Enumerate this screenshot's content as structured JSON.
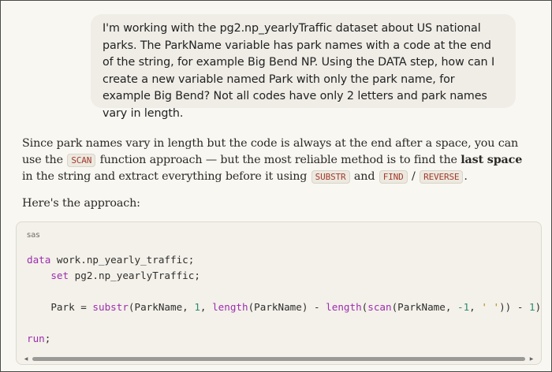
{
  "user_message": {
    "text": "I'm working with the pg2.np_yearlyTraffic dataset about US national parks. The ParkName variable has park names with a code at the end of the string, for example Big Bend NP. Using the DATA step, how can I create a new variable named Park with only the park name, for example Big Bend? Not all codes have only 2 letters and park names vary in length."
  },
  "assistant": {
    "para1_a": "Since park names vary in length but the code is always at the end after a space, you can use the ",
    "para1_code1": "SCAN",
    "para1_b": " function approach — but the most reliable method is to find the ",
    "para1_bold": "last space",
    "para1_c": " in the string and extract everything before it using ",
    "para1_code2": "SUBSTR",
    "para1_and": " and ",
    "para1_code3": "FIND",
    "para1_slash": " / ",
    "para1_code4": "REVERSE",
    "para1_end": ".",
    "para2": "Here's the approach:"
  },
  "code_block": {
    "language": "sas",
    "line1_kw": "data",
    "line1_rest": " work.np_yearly_traffic;",
    "line2_indent": "    ",
    "line2_kw": "set",
    "line2_rest": " pg2.np_yearlyTraffic;",
    "line3_a": "    Park = ",
    "line3_fn1": "substr",
    "line3_b": "(ParkName, ",
    "line3_n1": "1",
    "line3_c": ", ",
    "line3_fn2": "length",
    "line3_d": "(ParkName) - ",
    "line3_fn3": "length",
    "line3_e": "(",
    "line3_fn4": "scan",
    "line3_f": "(ParkName, ",
    "line3_n2": "-1",
    "line3_g": ", ",
    "line3_str": "' '",
    "line3_h": ")) - ",
    "line3_n3": "1",
    "line3_i": ");",
    "line4_kw": "run",
    "line4_rest": ";"
  },
  "scrollbar": {
    "left_arrow": "◀",
    "right_arrow": "▶"
  },
  "colors": {
    "background": "#f8f7f2",
    "user_bubble": "#efede6",
    "code_background": "#f3f1ea",
    "keyword": "#9d2dae",
    "number": "#2e8a6e",
    "inline_code_text": "#a23a2a"
  }
}
